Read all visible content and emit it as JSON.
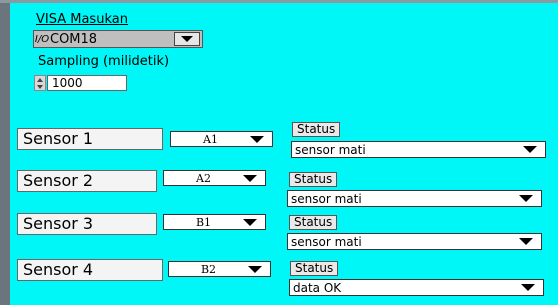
{
  "visa": {
    "label": "VISA Masukan",
    "io_glyph": "I/O",
    "value": "COM18"
  },
  "sampling": {
    "label": "Sampling (milidetik)",
    "value": "1000"
  },
  "sensors": [
    {
      "name": "Sensor 1",
      "channel": "A1",
      "status_label": "Status",
      "status": "sensor mati"
    },
    {
      "name": "Sensor 2",
      "channel": "A2",
      "status_label": "Status",
      "status": "sensor mati"
    },
    {
      "name": "Sensor 3",
      "channel": "B1",
      "status_label": "Status",
      "status": "sensor mati"
    },
    {
      "name": "Sensor 4",
      "channel": "B2",
      "status_label": "Status",
      "status": "data OK"
    }
  ],
  "colors": {
    "background": "#00f7f7",
    "frame": "#6c757d"
  }
}
